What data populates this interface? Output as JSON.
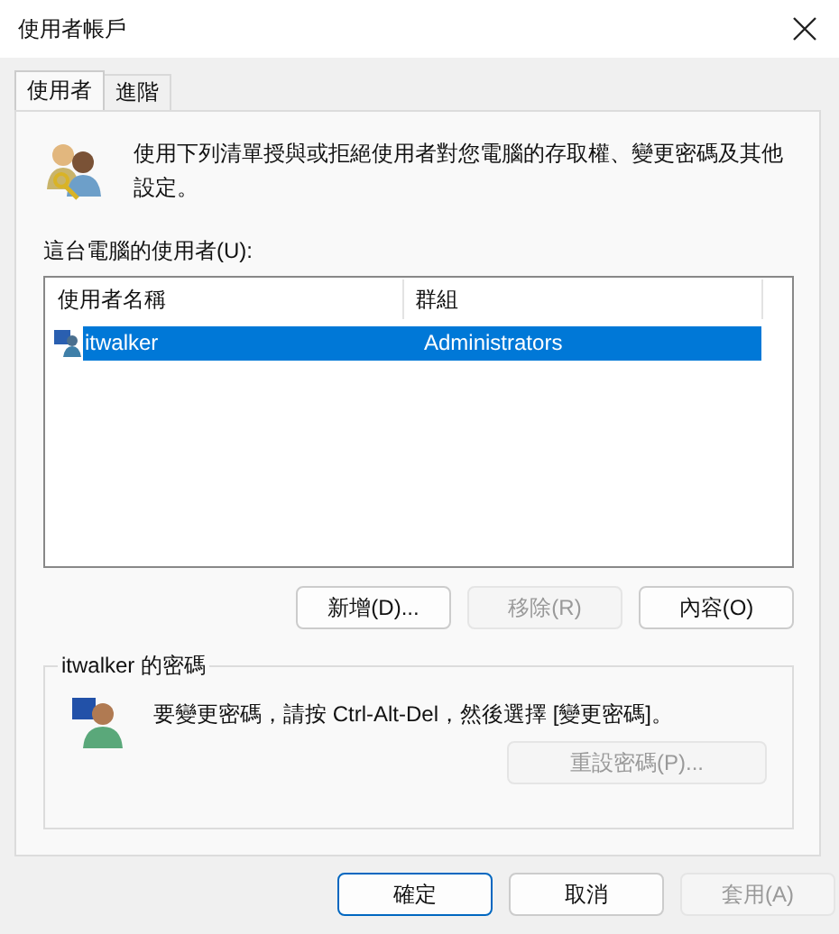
{
  "window": {
    "title": "使用者帳戶"
  },
  "tabs": [
    {
      "label": "使用者",
      "selected": true
    },
    {
      "label": "進階",
      "selected": false
    }
  ],
  "intro": "使用下列清單授與或拒絕使用者對您電腦的存取權、變更密碼及其他設定。",
  "users_label": "這台電腦的使用者(U):",
  "table": {
    "columns": [
      "使用者名稱",
      "群組"
    ],
    "rows": [
      {
        "name": "itwalker",
        "group": "Administrators",
        "selected": true
      }
    ]
  },
  "list_buttons": [
    {
      "label": "新增(D)...",
      "disabled": false
    },
    {
      "label": "移除(R)",
      "disabled": true
    },
    {
      "label": "內容(O)",
      "disabled": false
    }
  ],
  "password": {
    "title": "itwalker 的密碼",
    "text": "要變更密碼，請按 Ctrl-Alt-Del，然後選擇 [變更密碼]。",
    "button": {
      "label": "重設密碼(P)...",
      "disabled": true
    }
  },
  "dialog_buttons": [
    {
      "label": "確定",
      "disabled": false,
      "default": true
    },
    {
      "label": "取消",
      "disabled": false,
      "default": false
    },
    {
      "label": "套用(A)",
      "disabled": true,
      "default": false
    }
  ]
}
